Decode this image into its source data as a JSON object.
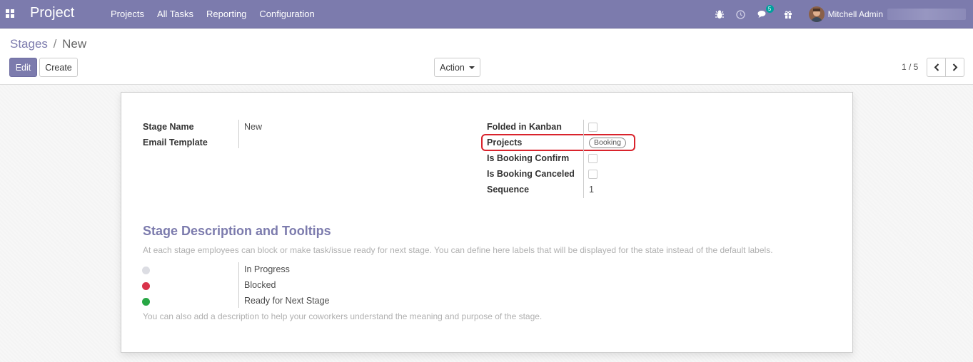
{
  "navbar": {
    "app_name": "Project",
    "menu": [
      "Projects",
      "All Tasks",
      "Reporting",
      "Configuration"
    ],
    "messages_count": "5",
    "user_name": "Mitchell Admin"
  },
  "breadcrumb": {
    "parent": "Stages",
    "separator": "/",
    "current": "New"
  },
  "buttons": {
    "edit": "Edit",
    "create": "Create",
    "action": "Action"
  },
  "pager": {
    "value": "1 / 5"
  },
  "form": {
    "stage_name_label": "Stage Name",
    "stage_name_value": "New",
    "email_template_label": "Email Template",
    "email_template_value": "",
    "folded_label": "Folded in Kanban",
    "projects_label": "Projects",
    "projects_tag": "Booking",
    "booking_confirm_label": "Is Booking Confirm",
    "booking_canceled_label": "Is Booking Canceled",
    "sequence_label": "Sequence",
    "sequence_value": "1"
  },
  "section": {
    "title": "Stage Description and Tooltips",
    "help": "At each stage employees can block or make task/issue ready for next stage. You can define here labels that will be displayed for the state instead of the default labels.",
    "legends": [
      {
        "label": "In Progress",
        "color": "#dcdde3"
      },
      {
        "label": "Blocked",
        "color": "#d9334a"
      },
      {
        "label": "Ready for Next Stage",
        "color": "#28a745"
      }
    ],
    "footer": "You can also add a description to help your coworkers understand the meaning and purpose of the stage."
  },
  "colors": {
    "brand": "#7c7bad",
    "highlight": "#d9232c"
  }
}
